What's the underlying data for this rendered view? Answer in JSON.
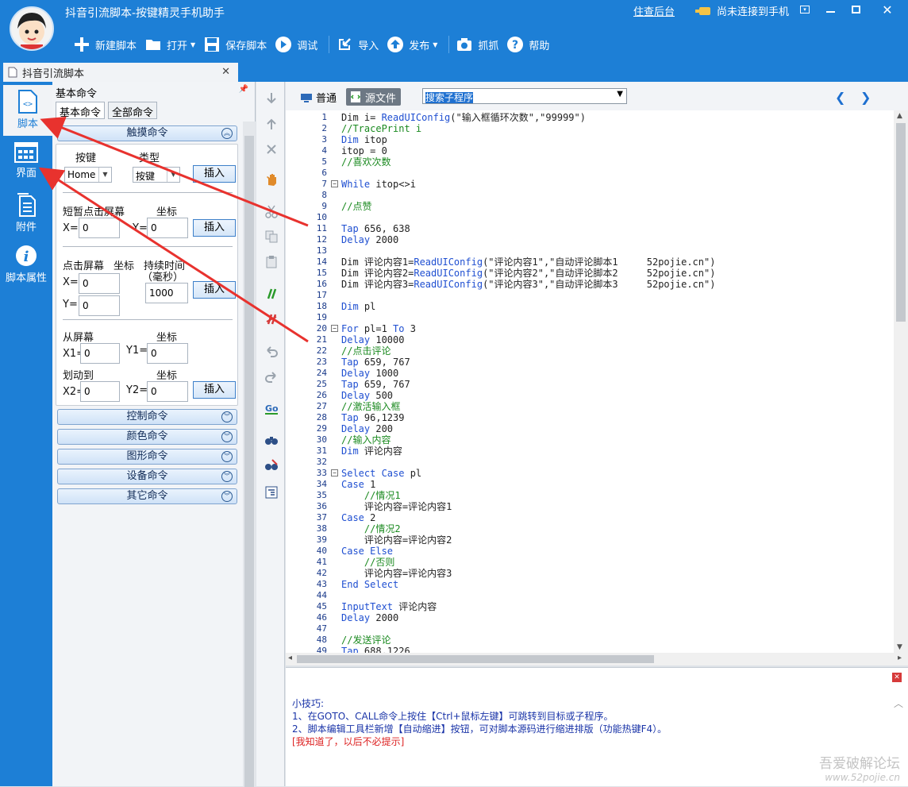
{
  "window": {
    "title": "抖音引流脚本-按键精灵手机助手",
    "backend_link": "住查后台",
    "connection_status": "尚未连接到手机"
  },
  "toolbar": {
    "new_script": "新建脚本",
    "open": "打开",
    "save_script": "保存脚本",
    "debug": "调试",
    "import": "导入",
    "publish": "发布",
    "capture": "抓抓",
    "help": "帮助"
  },
  "document_tab": {
    "label": "抖音引流脚本"
  },
  "leftnav": {
    "items": [
      {
        "label": "脚本",
        "icon": "script-icon"
      },
      {
        "label": "界面",
        "icon": "ui-grid-icon"
      },
      {
        "label": "附件",
        "icon": "attachment-icon"
      },
      {
        "label": "脚本属性",
        "icon": "info-icon"
      }
    ]
  },
  "cmdpanel": {
    "title": "基本命令",
    "subtabs": [
      "基本命令",
      "全部命令"
    ],
    "touch_section": {
      "header": "触摸命令",
      "key_label": "按键",
      "type_label": "类型",
      "key_value": "Home",
      "type_value": "按键",
      "insert": "插入",
      "short_tap_label": "短暂点击屏幕",
      "coord_label": "坐标",
      "x_label": "X=",
      "y_label": "Y=",
      "short_x": "0",
      "short_y": "0",
      "hold_label": "点击屏幕",
      "hold_coord_label": "坐标",
      "duration_label": "持续时间",
      "duration_unit": "（毫秒）",
      "hold_x": "0",
      "hold_y": "0",
      "duration": "1000",
      "from_screen_label": "从屏幕",
      "from_coord_label": "坐标",
      "x1_label": "X1=",
      "y1_label": "Y1=",
      "x1": "0",
      "y1": "0",
      "swipe_to_label": "划动到",
      "to_coord_label": "坐标",
      "x2_label": "X2=",
      "y2_label": "Y2=",
      "x2": "0",
      "y2": "0"
    },
    "other_sections": [
      "控制命令",
      "颜色命令",
      "图形命令",
      "设备命令",
      "其它命令"
    ]
  },
  "editor": {
    "mode_normal": "普通",
    "mode_source": "源文件",
    "subroutine_search": "搜索子程序",
    "lines": [
      {
        "n": "1",
        "parts": [
          [
            "st",
            "Dim i= "
          ],
          [
            "kw",
            "ReadUIConfig"
          ],
          [
            "st",
            "(\"输入框循环次数\",\"99999\")"
          ]
        ]
      },
      {
        "n": "2",
        "parts": [
          [
            "cm",
            "//TracePrint i"
          ]
        ]
      },
      {
        "n": "3",
        "parts": [
          [
            "kw",
            "Dim"
          ],
          [
            "st",
            " itop"
          ]
        ]
      },
      {
        "n": "4",
        "parts": [
          [
            "st",
            "itop = 0"
          ]
        ]
      },
      {
        "n": "5",
        "parts": [
          [
            "cm",
            "//喜欢次数"
          ]
        ]
      },
      {
        "n": "6",
        "parts": []
      },
      {
        "n": "7",
        "parts": [
          [
            "kw",
            "While"
          ],
          [
            "st",
            " itop<>i"
          ]
        ],
        "fold": true
      },
      {
        "n": "8",
        "parts": []
      },
      {
        "n": "9",
        "parts": [
          [
            "cm",
            "//点赞"
          ]
        ]
      },
      {
        "n": "10",
        "parts": []
      },
      {
        "n": "11",
        "parts": [
          [
            "kw",
            "Tap"
          ],
          [
            "st",
            " 656, 638"
          ]
        ]
      },
      {
        "n": "12",
        "parts": [
          [
            "kw",
            "Delay"
          ],
          [
            "st",
            " 2000"
          ]
        ]
      },
      {
        "n": "13",
        "parts": []
      },
      {
        "n": "14",
        "parts": [
          [
            "st",
            "Dim 评论内容1="
          ],
          [
            "kw",
            "ReadUIConfig"
          ],
          [
            "st",
            "(\"评论内容1\",\"自动评论脚本1     52pojie.cn\")"
          ]
        ]
      },
      {
        "n": "15",
        "parts": [
          [
            "st",
            "Dim 评论内容2="
          ],
          [
            "kw",
            "ReadUIConfig"
          ],
          [
            "st",
            "(\"评论内容2\",\"自动评论脚本2     52pojie.cn\")"
          ]
        ]
      },
      {
        "n": "16",
        "parts": [
          [
            "st",
            "Dim 评论内容3="
          ],
          [
            "kw",
            "ReadUIConfig"
          ],
          [
            "st",
            "(\"评论内容3\",\"自动评论脚本3     52pojie.cn\")"
          ]
        ]
      },
      {
        "n": "17",
        "parts": []
      },
      {
        "n": "18",
        "parts": [
          [
            "kw",
            "Dim"
          ],
          [
            "st",
            " pl"
          ]
        ]
      },
      {
        "n": "19",
        "parts": []
      },
      {
        "n": "20",
        "parts": [
          [
            "kw",
            "For"
          ],
          [
            "st",
            " pl=1 "
          ],
          [
            "kw",
            "To"
          ],
          [
            "st",
            " 3"
          ]
        ],
        "fold": true
      },
      {
        "n": "21",
        "parts": [
          [
            "kw",
            "Delay"
          ],
          [
            "st",
            " 10000"
          ]
        ]
      },
      {
        "n": "22",
        "parts": [
          [
            "cm",
            "//点击评论"
          ]
        ]
      },
      {
        "n": "23",
        "parts": [
          [
            "kw",
            "Tap"
          ],
          [
            "st",
            " 659, 767"
          ]
        ]
      },
      {
        "n": "24",
        "parts": [
          [
            "kw",
            "Delay"
          ],
          [
            "st",
            " 1000"
          ]
        ]
      },
      {
        "n": "25",
        "parts": [
          [
            "kw",
            "Tap"
          ],
          [
            "st",
            " 659, 767"
          ]
        ]
      },
      {
        "n": "26",
        "parts": [
          [
            "kw",
            "Delay"
          ],
          [
            "st",
            " 500"
          ]
        ]
      },
      {
        "n": "27",
        "parts": [
          [
            "cm",
            "//激活输入框"
          ]
        ]
      },
      {
        "n": "28",
        "parts": [
          [
            "kw",
            "Tap"
          ],
          [
            "st",
            " 96,1239"
          ]
        ]
      },
      {
        "n": "29",
        "parts": [
          [
            "kw",
            "Delay"
          ],
          [
            "st",
            " 200"
          ]
        ]
      },
      {
        "n": "30",
        "parts": [
          [
            "cm",
            "//输入内容"
          ]
        ]
      },
      {
        "n": "31",
        "parts": [
          [
            "kw",
            "Dim"
          ],
          [
            "st",
            " 评论内容"
          ]
        ]
      },
      {
        "n": "32",
        "parts": []
      },
      {
        "n": "33",
        "parts": [
          [
            "kw",
            "Select Case"
          ],
          [
            "st",
            " pl"
          ]
        ],
        "fold": true
      },
      {
        "n": "34",
        "parts": [
          [
            "kw",
            "Case"
          ],
          [
            "st",
            " 1"
          ]
        ]
      },
      {
        "n": "35",
        "parts": [
          [
            "cm",
            "    //情况1"
          ]
        ]
      },
      {
        "n": "36",
        "parts": [
          [
            "st",
            "    评论内容=评论内容1"
          ]
        ]
      },
      {
        "n": "37",
        "parts": [
          [
            "kw",
            "Case"
          ],
          [
            "st",
            " 2"
          ]
        ]
      },
      {
        "n": "38",
        "parts": [
          [
            "cm",
            "    //情况2"
          ]
        ]
      },
      {
        "n": "39",
        "parts": [
          [
            "st",
            "    评论内容=评论内容2"
          ]
        ]
      },
      {
        "n": "40",
        "parts": [
          [
            "kw",
            "Case Else"
          ]
        ]
      },
      {
        "n": "41",
        "parts": [
          [
            "cm",
            "    //否则"
          ]
        ]
      },
      {
        "n": "42",
        "parts": [
          [
            "st",
            "    评论内容=评论内容3"
          ]
        ]
      },
      {
        "n": "43",
        "parts": [
          [
            "kw",
            "End Select"
          ]
        ]
      },
      {
        "n": "44",
        "parts": []
      },
      {
        "n": "45",
        "parts": [
          [
            "kw",
            "InputText"
          ],
          [
            "st",
            " 评论内容"
          ]
        ]
      },
      {
        "n": "46",
        "parts": [
          [
            "kw",
            "Delay"
          ],
          [
            "st",
            " 2000"
          ]
        ]
      },
      {
        "n": "47",
        "parts": []
      },
      {
        "n": "48",
        "parts": [
          [
            "cm",
            "//发送评论"
          ]
        ]
      },
      {
        "n": "49",
        "parts": [
          [
            "kw",
            "Tap"
          ],
          [
            "st",
            " 688,1226"
          ]
        ]
      }
    ]
  },
  "tips": {
    "title": "小技巧:",
    "tip1": "1、在GOTO、CALL命令上按住【Ctrl+鼠标左键】可跳转到目标或子程序。",
    "tip2": "2、脚本编辑工具栏新增【自动缩进】按钮，可对脚本源码进行缩进排版（功能热键F4）。",
    "dismiss": "[我知道了，以后不必提示]"
  },
  "watermark": {
    "line1": "吾爱破解论坛",
    "line2": "www.52pojie.cn"
  },
  "colors": {
    "brand_blue": "#1d7fd6",
    "annotation_red": "#e8322e",
    "keyword": "#1f4fd1",
    "comment": "#1b8a20"
  }
}
